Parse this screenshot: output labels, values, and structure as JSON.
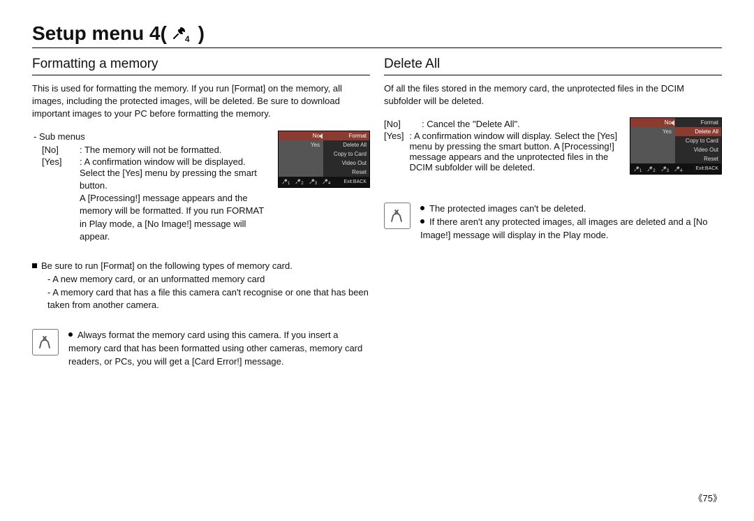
{
  "pageTitle": "Setup menu 4(",
  "pageTitleClose": ")",
  "wrenchSub": "4",
  "pageNumber": "75",
  "left": {
    "heading": "Formatting a memory",
    "intro": "This is used for formatting the memory. If you run [Format] on the memory, all images, including the protected images, will be deleted. Be sure to download important images to your PC before formatting the memory.",
    "subMenusLabel": "- Sub menus",
    "noLabel": "[No]",
    "noText": ": The memory will not be formatted.",
    "yesLabel": "[Yes]",
    "yesText": ": A confirmation window will be displayed.",
    "yesMore1": "Select the [Yes] menu by pressing the smart button.",
    "yesMore2": "A [Processing!] message appears and the memory will be formatted. If you run FORMAT in Play mode, a [No Image!] message will appear.",
    "beSureLine": "Be sure to run [Format] on the following types of memory card.",
    "beSureA": "- A new memory card, or an unformatted memory card",
    "beSureB": "- A memory card that has a file this camera can't recognise or one that has been taken from another camera.",
    "note": "Always format the memory card using this camera. If you insert a memory card that has been formatted using other cameras, memory card readers, or PCs, you will get a [Card Error!] message."
  },
  "right": {
    "heading": "Delete All",
    "intro": "Of all the files stored in the memory card, the unprotected files in the DCIM subfolder will be deleted.",
    "noLabel": "[No]",
    "noText": ": Cancel the \"Delete All\".",
    "yesLabel": "[Yes]",
    "yesText": ": A confirmation window will display. Select the [Yes] menu by pressing the smart button. A [Processing!] message appears and the unprotected files in the DCIM subfolder will be deleted.",
    "noteA": "The protected images can't be deleted.",
    "noteB": "If there aren't any protected images, all images are deleted and a [No Image!] message will display in the Play mode."
  },
  "miniLeft": {
    "leftOptions": [
      "No",
      "Yes",
      "",
      "",
      ""
    ],
    "rightOptions": [
      "Format",
      "Delete All",
      "Copy to Card",
      "Video Out",
      "Reset"
    ],
    "footer": "Exit:BACK",
    "selectedRight": 0
  },
  "miniRight": {
    "leftOptions": [
      "No",
      "Yes",
      "",
      "",
      ""
    ],
    "rightOptions": [
      "Format",
      "Delete All",
      "Copy to Card",
      "Video Out",
      "Reset"
    ],
    "footer": "Exit:BACK",
    "selectedRight": 1
  }
}
